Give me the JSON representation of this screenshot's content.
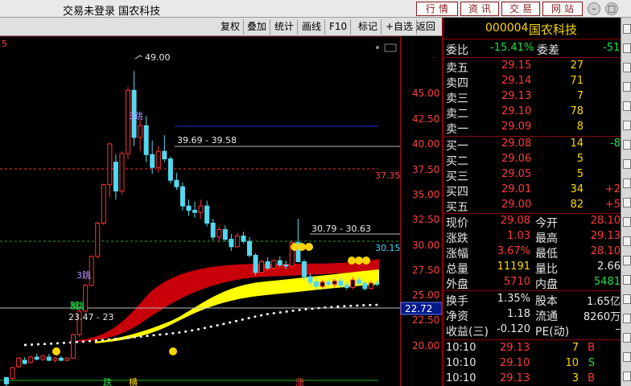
{
  "window": {
    "title": "交易未登录  国农科技",
    "nav_buttons": [
      "行情",
      "资讯",
      "交易",
      "网站"
    ]
  },
  "toolbar": {
    "items": [
      "复权",
      "叠加",
      "统计",
      "画线",
      "F10",
      "标记",
      "+自选",
      "返回"
    ]
  },
  "chart": {
    "corner_label": "5",
    "price_labels": [
      "45.00",
      "42.50",
      "40.00",
      "37.50",
      "35.00",
      "32.50",
      "30.00",
      "27.50",
      "25.00",
      "22.50",
      "20.00"
    ],
    "annotations": {
      "high": "49.00",
      "range1": "39.69 - 39.58",
      "range2": "30.79 - 30.63",
      "range3": "23.47 - 23",
      "line_3735": "37.35",
      "line_3015": "30.15",
      "current_box": "22.72"
    },
    "bottom_tags": [
      "跌",
      "横",
      "涨"
    ],
    "marker_texts": [
      "3跳",
      "3跳",
      "3跳",
      "跳"
    ],
    "colors": {
      "up": "#ff3030",
      "down": "#54d8f0",
      "band_red": "#c8000a",
      "band_yellow": "#ffff00",
      "blue_line": "#2233dd",
      "red_dash": "#ff3333",
      "green_line": "#22aa22"
    },
    "chart_data": {
      "type": "candlestick",
      "ylim": [
        19,
        50
      ],
      "candles": [
        [
          20.4,
          20.4,
          19.6,
          19.8,
          19.5
        ],
        [
          20.3,
          21.4,
          20.2,
          21.3,
          20.1
        ],
        [
          21.4,
          22.3,
          21.3,
          22.2,
          21.2
        ],
        [
          22.0,
          22.3,
          21.6,
          21.7,
          21.5
        ],
        [
          21.8,
          22.4,
          21.7,
          22.3,
          21.6
        ],
        [
          22.3,
          22.6,
          22.0,
          22.1,
          21.9
        ],
        [
          22.1,
          22.5,
          21.9,
          22.4,
          21.8
        ],
        [
          22.3,
          22.6,
          21.9,
          22.0,
          21.8
        ],
        [
          22.0,
          22.3,
          21.8,
          22.2,
          21.7
        ],
        [
          22.2,
          22.4,
          21.9,
          22.0,
          21.8
        ],
        [
          22.0,
          22.3,
          21.9,
          22.2,
          21.8
        ],
        [
          22.2,
          24.5,
          22.1,
          24.4,
          22.0
        ],
        [
          24.4,
          26.7,
          24.2,
          26.6,
          24.0
        ],
        [
          26.6,
          29.1,
          26.4,
          29.0,
          26.2
        ],
        [
          29.0,
          31.8,
          28.9,
          31.7,
          28.7
        ],
        [
          31.7,
          34.9,
          31.5,
          34.8,
          31.2
        ],
        [
          34.8,
          38.5,
          34.6,
          38.4,
          34.0
        ],
        [
          38.4,
          42.3,
          37.2,
          42.2,
          36.9
        ],
        [
          40.5,
          41.2,
          37.0,
          37.8,
          36.8
        ],
        [
          37.8,
          41.5,
          37.5,
          41.3,
          37.2
        ],
        [
          41.3,
          47.5,
          40.8,
          47.2,
          40.5
        ],
        [
          47.2,
          49.0,
          42.0,
          42.8,
          41.5
        ],
        [
          42.8,
          44.5,
          41.5,
          43.9,
          41.0
        ],
        [
          43.9,
          44.8,
          40.5,
          41.2,
          40.0
        ],
        [
          41.2,
          42.5,
          39.4,
          40.0,
          39.0
        ],
        [
          40.0,
          42.0,
          39.5,
          41.5,
          39.2
        ],
        [
          41.5,
          43.0,
          40.5,
          40.8,
          40.1
        ],
        [
          40.8,
          41.0,
          38.5,
          38.8,
          38.0
        ],
        [
          38.8,
          39.5,
          37.9,
          38.2,
          37.5
        ],
        [
          38.2,
          38.6,
          36.0,
          36.4,
          35.8
        ],
        [
          36.4,
          37.0,
          35.5,
          36.0,
          35.2
        ],
        [
          36.0,
          36.8,
          35.3,
          35.8,
          35.0
        ],
        [
          35.8,
          37.0,
          35.2,
          36.4,
          35.0
        ],
        [
          36.4,
          36.9,
          34.5,
          34.8,
          34.2
        ],
        [
          34.8,
          35.2,
          33.2,
          33.5,
          33.0
        ],
        [
          33.5,
          34.5,
          33.0,
          34.2,
          32.8
        ],
        [
          34.2,
          34.6,
          33.1,
          33.3,
          32.9
        ],
        [
          33.3,
          33.8,
          32.2,
          32.6,
          32.0
        ],
        [
          32.6,
          33.9,
          32.5,
          33.6,
          32.3
        ],
        [
          33.6,
          34.0,
          32.9,
          33.1,
          32.7
        ],
        [
          33.1,
          33.5,
          31.6,
          31.8,
          31.4
        ],
        [
          31.8,
          32.0,
          29.9,
          30.2,
          29.7
        ],
        [
          30.2,
          31.4,
          30.1,
          31.2,
          29.9
        ],
        [
          31.2,
          31.6,
          30.4,
          30.6,
          30.2
        ],
        [
          30.6,
          31.5,
          30.5,
          31.3,
          30.3
        ],
        [
          31.3,
          31.7,
          30.7,
          30.9,
          30.5
        ],
        [
          30.9,
          31.3,
          30.5,
          30.8,
          30.3
        ],
        [
          30.8,
          33.2,
          30.7,
          33.0,
          30.5
        ],
        [
          33.0,
          35.2,
          32.8,
          31.2,
          30.6
        ],
        [
          31.2,
          31.4,
          29.5,
          29.8,
          29.3
        ],
        [
          29.8,
          30.1,
          29.0,
          29.3,
          28.8
        ],
        [
          29.3,
          29.6,
          28.6,
          28.9,
          28.4
        ],
        [
          28.9,
          29.5,
          28.7,
          29.3,
          28.5
        ],
        [
          29.3,
          29.5,
          28.9,
          29.1,
          28.7
        ],
        [
          29.1,
          29.6,
          28.8,
          29.4,
          28.6
        ],
        [
          29.4,
          29.7,
          28.8,
          29.0,
          28.6
        ],
        [
          29.0,
          29.3,
          28.6,
          28.8,
          28.4
        ],
        [
          28.8,
          29.8,
          28.6,
          29.5,
          28.4
        ],
        [
          29.5,
          29.8,
          29.0,
          29.2,
          28.8
        ],
        [
          29.2,
          29.4,
          28.5,
          28.7,
          28.3
        ],
        [
          28.7,
          29.4,
          28.6,
          29.2,
          28.4
        ],
        [
          29.2,
          29.5,
          28.9,
          29.1,
          28.7
        ]
      ]
    }
  },
  "quote": {
    "code": "000004",
    "name": "国农科技",
    "weibi_label": "委比",
    "weibi": "-15.41%",
    "weicha_label": "委差",
    "weicha": "-51",
    "asks": [
      {
        "label": "卖五",
        "price": "29.15",
        "vol": "27",
        "chg": ""
      },
      {
        "label": "卖四",
        "price": "29.14",
        "vol": "71",
        "chg": ""
      },
      {
        "label": "卖三",
        "price": "29.13",
        "vol": "7",
        "chg": ""
      },
      {
        "label": "卖二",
        "price": "29.10",
        "vol": "78",
        "chg": ""
      },
      {
        "label": "卖一",
        "price": "29.09",
        "vol": "8",
        "chg": ""
      }
    ],
    "bids": [
      {
        "label": "买一",
        "price": "29.08",
        "vol": "14",
        "chg": "-8"
      },
      {
        "label": "买二",
        "price": "29.06",
        "vol": "5",
        "chg": ""
      },
      {
        "label": "买三",
        "price": "29.05",
        "vol": "5",
        "chg": ""
      },
      {
        "label": "买四",
        "price": "29.01",
        "vol": "34",
        "chg": "+2"
      },
      {
        "label": "买五",
        "price": "29.00",
        "vol": "82",
        "chg": "+5"
      }
    ],
    "stats": [
      {
        "l1": "现价",
        "v1": "29.08",
        "l2": "今开",
        "v2": "28.10"
      },
      {
        "l1": "涨跌",
        "v1": "1.03",
        "l2": "最高",
        "v2": "29.13"
      },
      {
        "l1": "涨幅",
        "v1": "3.67%",
        "l2": "最低",
        "v2": "28.10"
      },
      {
        "l1": "总量",
        "v1": "11191",
        "l2": "量比",
        "v2": "2.66"
      },
      {
        "l1": "外盘",
        "v1": "5710",
        "l2": "内盘",
        "v2": "5481"
      }
    ],
    "stats2": [
      {
        "l1": "换手",
        "v1": "1.35%",
        "l2": "股本",
        "v2": "1.65亿"
      },
      {
        "l1": "净资",
        "v1": "1.18",
        "l2": "流通",
        "v2": "8260万"
      },
      {
        "l1": "收益(三)",
        "v1": "-0.120",
        "l2": "PE(动)",
        "v2": "–"
      }
    ],
    "ticks": [
      {
        "time": "10:10",
        "price": "29.13",
        "vol": "7",
        "side": "B"
      },
      {
        "time": "10:10",
        "price": "29.10",
        "vol": "10",
        "side": "S"
      },
      {
        "time": "10:10",
        "price": "29.13",
        "vol": "3",
        "side": "B"
      }
    ]
  }
}
